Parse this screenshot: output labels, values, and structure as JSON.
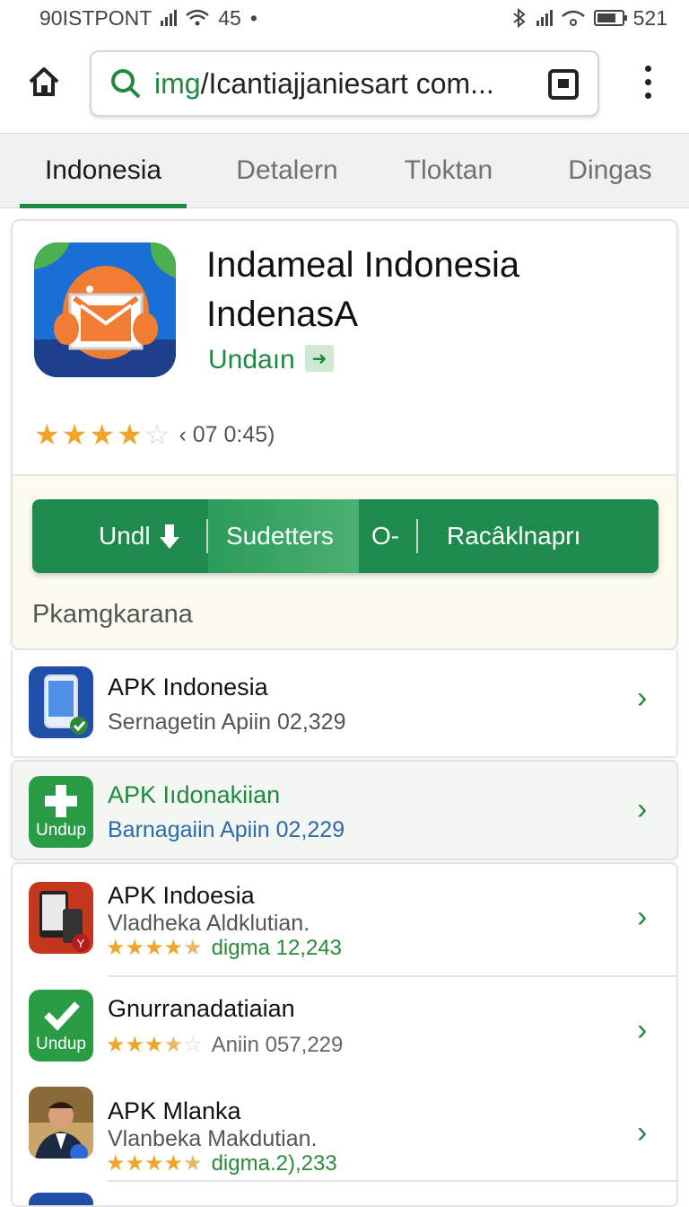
{
  "status_bar": {
    "left_text": "90ISTPONT",
    "time": "45",
    "dot": "•",
    "battery": "521"
  },
  "browser": {
    "url_prefix": "img",
    "url_rest": "/Icantiajjaniesart com..."
  },
  "tabs": [
    {
      "label": "Indonesia",
      "active": true
    },
    {
      "label": "Detalern",
      "active": false
    },
    {
      "label": "Tloktan",
      "active": false
    },
    {
      "label": "Dingas",
      "active": false
    }
  ],
  "app": {
    "title_line1": "Indameal Indonesia",
    "title_line2": "IndenasA",
    "developer": "Undaın",
    "rating_stars": 4,
    "rating_text": "‹ 07 0:45)"
  },
  "action_bar": {
    "download": "Undl",
    "details": "Sudetters",
    "more": "O-",
    "report": "Racâklnaprı"
  },
  "section_label": "Pkamgkarana",
  "list": [
    {
      "title": "APK Indonesia",
      "subtitle": "Sernagetin Apiin 02,329",
      "icon": "phone-app-icon"
    },
    {
      "title": "APK Iıdonakiian",
      "subtitle": "Barnagaiin Apiin 02,229",
      "icon_label": "Undup",
      "icon": "plus-download-icon",
      "highlight_color": "#1f8a3f",
      "sub_color": "#2d6aa8"
    },
    {
      "title": "APK Indoesia",
      "subtitle": "Vladheka Aldklutian.",
      "stars": 4.5,
      "meta": "digma 12,243",
      "icon": "phone-gallery-app-icon"
    },
    {
      "title": "Gnurranadatiaian",
      "stars": 3.5,
      "meta": "Aniin 057,229",
      "icon_label": "Undup",
      "icon": "check-app-icon"
    },
    {
      "title": "APK Mlanka",
      "subtitle": "Vlanbeka Makdutian.",
      "stars": 4.5,
      "meta": "digma.2),233",
      "icon": "person-photo-icon"
    }
  ],
  "colors": {
    "accent_green": "#1f8a3f",
    "action_bar": "#1f8a4d",
    "star": "#f0a42a"
  }
}
